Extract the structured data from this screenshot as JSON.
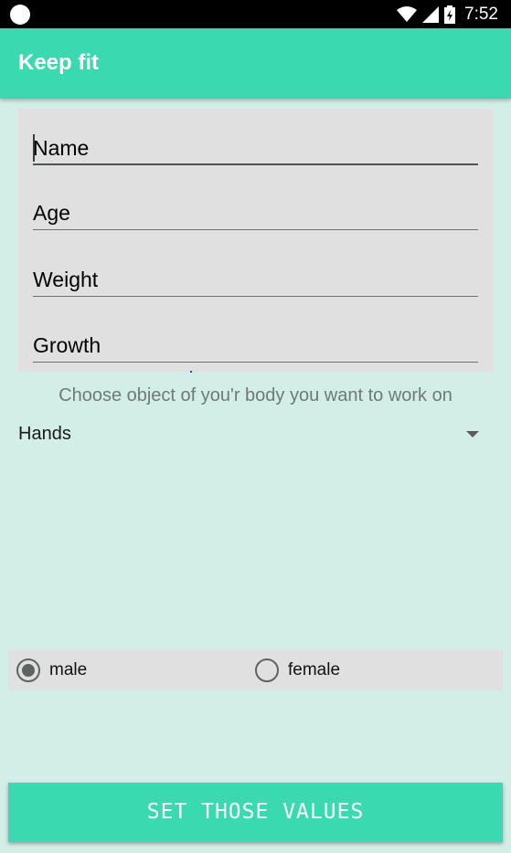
{
  "status_bar": {
    "time": "7:52",
    "icons": [
      "circle-icon",
      "wifi-icon",
      "signal-icon",
      "battery-icon"
    ]
  },
  "app_bar": {
    "title": "Keep fit"
  },
  "form": {
    "fields": [
      {
        "text": "Name",
        "focused": true
      },
      {
        "text": "Age",
        "focused": false
      },
      {
        "text": "Weight",
        "focused": false
      },
      {
        "text": "Growth",
        "focused": false
      }
    ]
  },
  "body_section": {
    "prompt": "Choose object of you'r body you want to work on",
    "selected_value": "Hands"
  },
  "gender": {
    "options": [
      {
        "label": "male",
        "checked": true
      },
      {
        "label": "female",
        "checked": false
      }
    ]
  },
  "submit": {
    "label": "SET THOSE VALUES"
  },
  "colors": {
    "accent": "#3ad9b0",
    "background": "#d3ede7",
    "card": "#e0e0e0"
  }
}
